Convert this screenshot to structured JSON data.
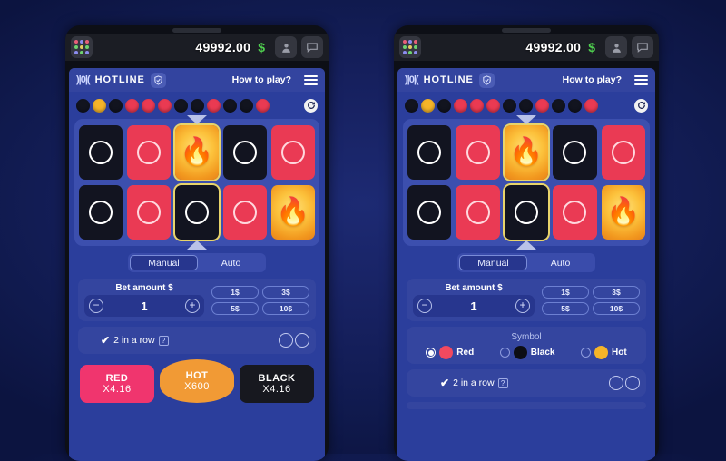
{
  "statusbar": {
    "balance": "49992.00",
    "currency_symbol": "$",
    "grid_icon": "apps-grid-icon",
    "profile_icon": "user-icon",
    "chat_icon": "chat-icon"
  },
  "game_header": {
    "brand": "HOTLINE",
    "verified_icon": "shield-check-icon",
    "how_to_play": "How to play?",
    "menu_icon": "hamburger-menu-icon",
    "refresh_icon": "refresh-icon"
  },
  "history": {
    "dots": [
      "black",
      "hot",
      "black",
      "red",
      "red",
      "red",
      "black",
      "black",
      "red",
      "black",
      "black",
      "red"
    ],
    "colors": {
      "black": "#12141f",
      "red": "#ea3a52",
      "hot": "#f5b429"
    }
  },
  "board": {
    "rows": [
      [
        {
          "type": "black",
          "selected": false
        },
        {
          "type": "red",
          "selected": false
        },
        {
          "type": "hot",
          "selected": true
        },
        {
          "type": "black",
          "selected": false
        },
        {
          "type": "red",
          "selected": false
        }
      ],
      [
        {
          "type": "black",
          "selected": false
        },
        {
          "type": "red",
          "selected": false
        },
        {
          "type": "black",
          "selected": true
        },
        {
          "type": "red",
          "selected": false
        },
        {
          "type": "hot",
          "selected": false
        }
      ]
    ],
    "flame_glyph": "🔥"
  },
  "controls": {
    "tabs": [
      {
        "label": "Manual",
        "active": true
      },
      {
        "label": "Auto",
        "active": false
      }
    ],
    "bet": {
      "label": "Bet amount $",
      "value": "1",
      "minus": "−",
      "plus": "+",
      "quick_amounts": [
        "1$",
        "3$",
        "5$",
        "10$"
      ]
    },
    "symbol": {
      "title": "Symbol",
      "options": [
        {
          "label": "Red",
          "selected": true,
          "color": "#f2495f"
        },
        {
          "label": "Black",
          "selected": false,
          "color": "#0c0d14"
        },
        {
          "label": "Hot",
          "selected": false,
          "color": "#f5b429"
        }
      ]
    },
    "in_a_row": {
      "check": "✔",
      "label": "2 in a row",
      "help": "?"
    },
    "bet_buttons": [
      {
        "name": "RED",
        "multiplier": "X4.16",
        "style": "red"
      },
      {
        "name": "HOT",
        "multiplier": "X600",
        "style": "hot"
      },
      {
        "name": "BLACK",
        "multiplier": "X4.16",
        "style": "black"
      }
    ]
  },
  "accent_colors": {
    "page_bg": "#16205e",
    "screen_bg": "#2b3e9c",
    "panel_bg": "#34459f",
    "board_bg": "#3c4fae",
    "highlight": "#e8d46a"
  }
}
